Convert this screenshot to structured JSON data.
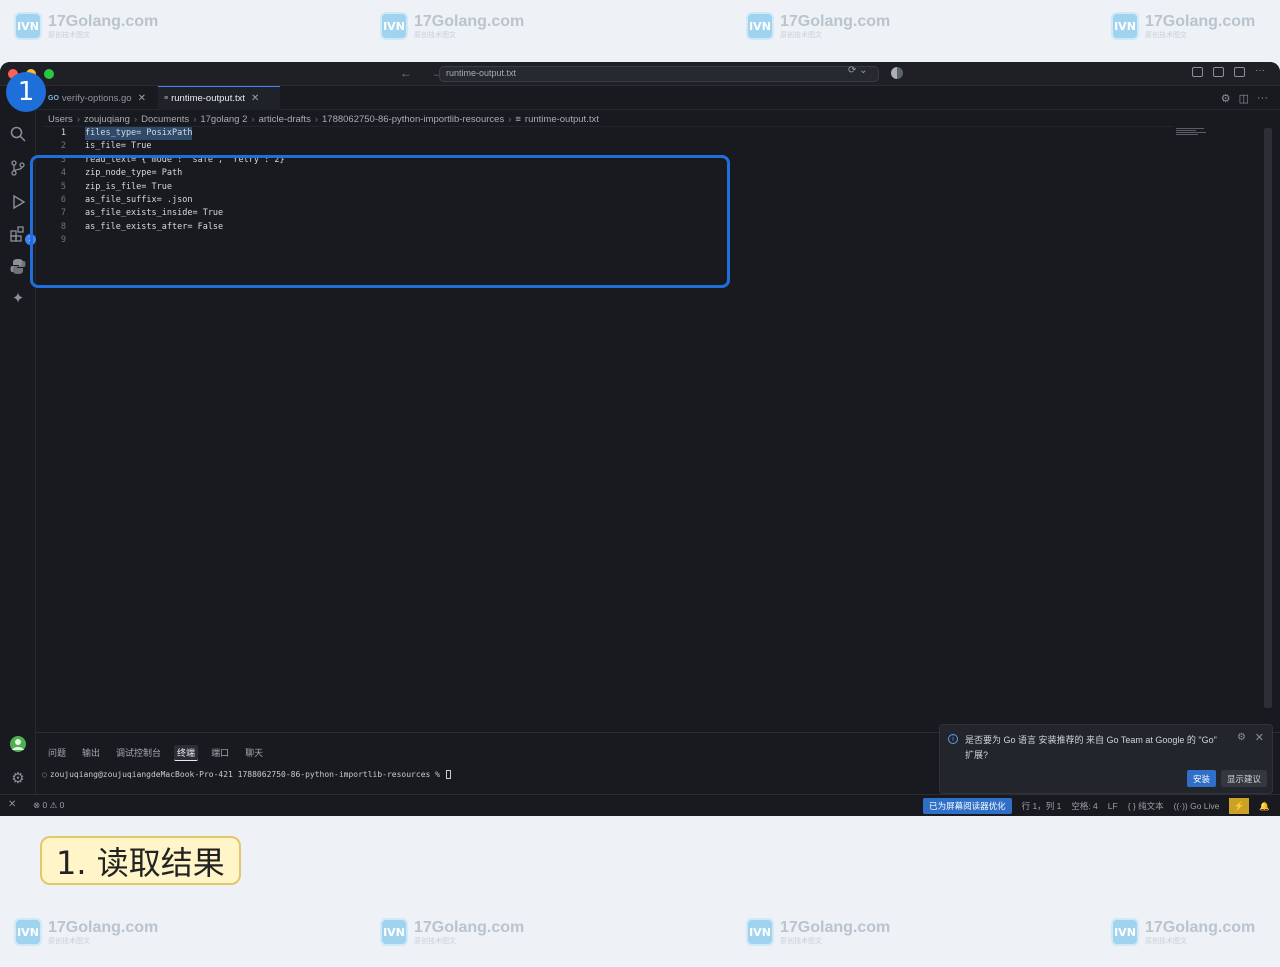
{
  "watermark": {
    "logo": "IVN",
    "title": "17Golang.com",
    "subtitle": "原创技术图文"
  },
  "window": {
    "nav_arrows": "← →",
    "command_center": "runtime-output.txt"
  },
  "tabs": [
    {
      "label": "verify-options.go",
      "icon": "GO"
    },
    {
      "label": "runtime-output.txt",
      "icon": "≡"
    }
  ],
  "breadcrumb": [
    "Users",
    "zoujuqiang",
    "Documents",
    "17golang 2",
    "article-drafts",
    "1788062750-86-python-importlib-resources",
    "runtime-output.txt"
  ],
  "editor": {
    "lines": [
      {
        "num": "1",
        "text": "files_type= PosixPath"
      },
      {
        "num": "2",
        "text": "is_file= True"
      },
      {
        "num": "3",
        "text": "read_text= {\"mode\": \"safe\", \"retry\": 2}"
      },
      {
        "num": "4",
        "text": "zip_node_type= Path"
      },
      {
        "num": "5",
        "text": "zip_is_file= True"
      },
      {
        "num": "6",
        "text": "as_file_suffix= .json"
      },
      {
        "num": "7",
        "text": "as_file_exists_inside= True"
      },
      {
        "num": "8",
        "text": "as_file_exists_after= False"
      },
      {
        "num": "9",
        "text": ""
      }
    ]
  },
  "callout": {
    "number": "1"
  },
  "panel": {
    "tabs": [
      "问题",
      "输出",
      "调试控制台",
      "终端",
      "端口",
      "聊天"
    ],
    "active_tab": "终端",
    "terminal_prompt": "zoujuqiang@zoujuqiangdeMacBook-Pro-421 1788062750-86-python-importlib-resources %"
  },
  "activity": {
    "extensions_badge": "1"
  },
  "notification": {
    "text": "是否要为 Go 语言 安装推荐的 来自 Go Team at Google 的 \"Go\" 扩展?",
    "install_label": "安装",
    "suggest_label": "显示建议"
  },
  "statusbar": {
    "errors": "0",
    "warnings": "0",
    "screen_reader": "已为屏幕阅读器优化",
    "position": "行 1，列 1",
    "spaces": "空格: 4",
    "eol": "LF",
    "language": "{ } 纯文本",
    "go_live": "Go Live"
  },
  "caption": "1. 读取结果"
}
